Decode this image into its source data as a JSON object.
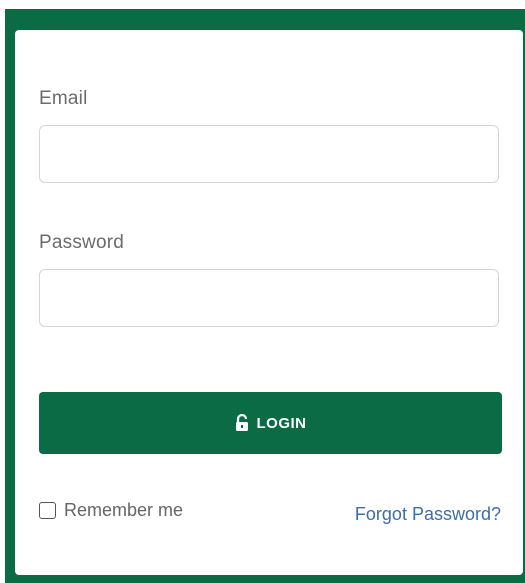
{
  "form": {
    "email_label": "Email",
    "email_value": "",
    "password_label": "Password",
    "password_value": "",
    "login_label": "LOGIN",
    "remember_label": "Remember me",
    "remember_checked": false,
    "forgot_label": "Forgot Password?"
  },
  "icons": {
    "login_icon": "unlock-icon"
  },
  "colors": {
    "brand_green": "#0b6b45",
    "link_blue": "#3a6fa8"
  }
}
